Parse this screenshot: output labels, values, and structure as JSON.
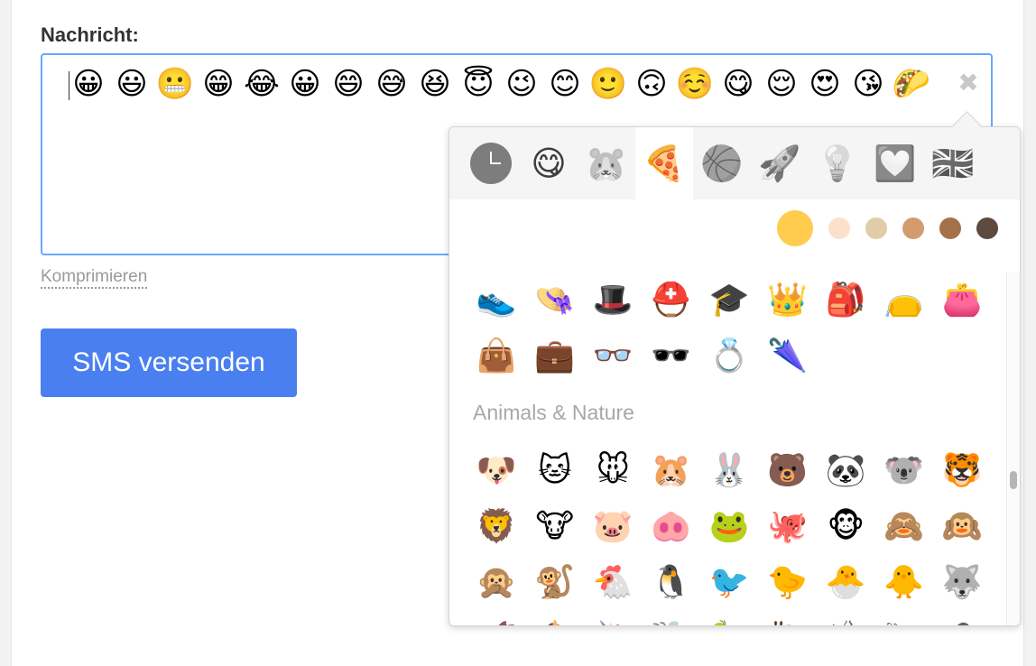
{
  "form": {
    "label": "Nachricht:",
    "message_emojis": [
      "😀",
      "😃",
      "😬",
      "😁",
      "😂",
      "😀",
      "😄",
      "😅",
      "😆",
      "😇",
      "😉",
      "😊",
      "🙂",
      "🙃",
      "☺️",
      "😋",
      "😌",
      "😍",
      "😘",
      "🌮"
    ],
    "clear_glyph": "✖",
    "compress_link": "Komprimieren",
    "send_button": "SMS versenden"
  },
  "picker": {
    "categories": [
      {
        "name": "recent",
        "icon": "clock-icon",
        "glyph": "🕒"
      },
      {
        "name": "people",
        "icon": "face-icon",
        "glyph": "😋"
      },
      {
        "name": "animals",
        "icon": "hamster-icon",
        "glyph": "🐹"
      },
      {
        "name": "food",
        "icon": "pizza-icon",
        "glyph": "🍕"
      },
      {
        "name": "activity",
        "icon": "basketball-icon",
        "glyph": "🏀"
      },
      {
        "name": "travel",
        "icon": "rocket-icon",
        "glyph": "🚀"
      },
      {
        "name": "objects",
        "icon": "lightbulb-icon",
        "glyph": "💡"
      },
      {
        "name": "symbols",
        "icon": "heart-icon",
        "glyph": "💟"
      },
      {
        "name": "flags",
        "icon": "flag-icon",
        "glyph": "🇬🇧"
      }
    ],
    "active_category": 3,
    "skin_tones": [
      "#ffcc4d",
      "#fbe0cc",
      "#e0cca6",
      "#d39c6e",
      "#a3724a",
      "#5c4a3f"
    ],
    "active_tone": 0,
    "people_rows": [
      [
        "👟",
        "👒",
        "🎩",
        "⛑️",
        "🎓",
        "👑",
        "🎒",
        "👝",
        "👛"
      ],
      [
        "👜",
        "💼",
        "👓",
        "🕶️",
        "💍",
        "🌂"
      ]
    ],
    "animals_title": "Animals & Nature",
    "animal_rows": [
      [
        "🐶",
        "🐱",
        "🐭",
        "🐹",
        "🐰",
        "🐻",
        "🐼",
        "🐨",
        "🐯"
      ],
      [
        "🦁",
        "🐮",
        "🐷",
        "🐽",
        "🐸",
        "🐙",
        "🐵",
        "🙈",
        "🙉"
      ],
      [
        "🙊",
        "🐒",
        "🐔",
        "🐧",
        "🐦",
        "🐤",
        "🐣",
        "🐥",
        "🐺"
      ],
      [
        "🐗",
        "🐴",
        "🦄",
        "🐝",
        "🐛",
        "🐌",
        "🐞",
        "🐜",
        "🕷️"
      ]
    ]
  }
}
